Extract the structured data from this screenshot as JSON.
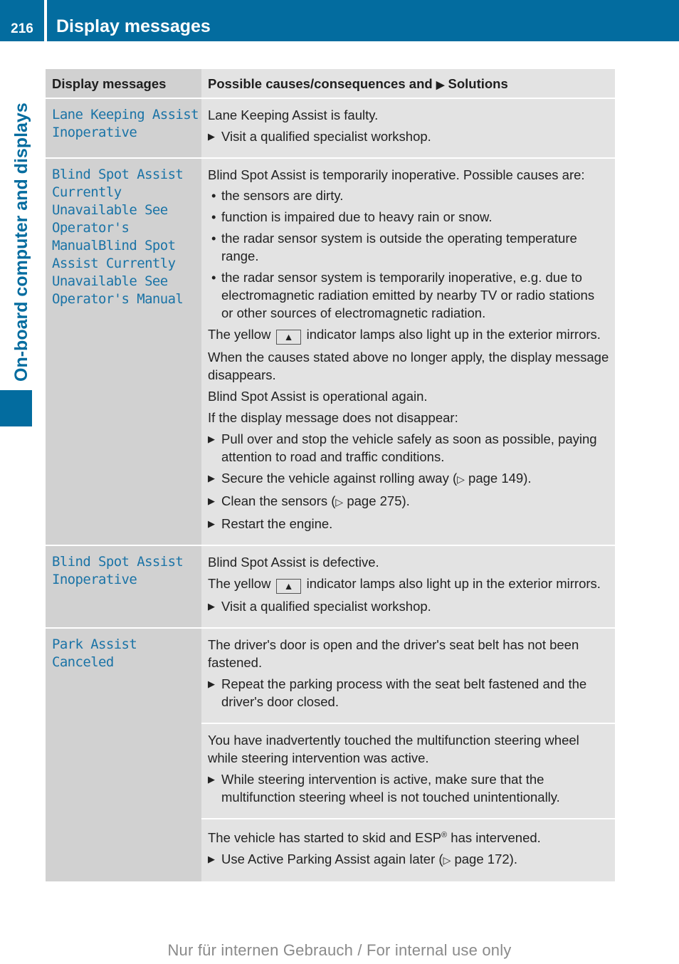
{
  "header": {
    "page_number": "216",
    "title": "Display messages",
    "side_tab": "On-board computer and displays",
    "accent_color": "#036c9f"
  },
  "table": {
    "col1_header": "Display messages",
    "col2_header_pre": "Possible causes/consequences and",
    "col2_header_marker": "▶",
    "col2_header_post": "Solutions",
    "rows": [
      {
        "message": "Lane Keeping Assist Inoperative",
        "blocks": [
          {
            "intro": "Lane Keeping Assist is faulty.",
            "steps": [
              "Visit a qualified specialist workshop."
            ]
          }
        ]
      },
      {
        "message": "Blind Spot Assist Currently Unavailable See Operator's ManualBlind Spot Assist Currently Unavailable See Operator's Manual",
        "intro": "Blind Spot Assist is temporarily inoperative. Possible causes are:",
        "bullets": [
          "the sensors are dirty.",
          "function is impaired due to heavy rain or snow.",
          "the radar sensor system is outside the operating temperature range.",
          "the radar sensor system is temporarily inoperative, e.g. due to electromagnetic radiation emitted by nearby TV or radio stations or other sources of electromagnetic radiation."
        ],
        "lamp_pre": "The yellow",
        "lamp_icon": "▲",
        "lamp_post": "indicator lamps also light up in the exterior mirrors.",
        "p1": "When the causes stated above no longer apply, the display message disappears.",
        "p2": "Blind Spot Assist is operational again.",
        "p3": "If the display message does not disappear:",
        "steps": [
          {
            "text": "Pull over and stop the vehicle safely as soon as possible, paying attention to road and traffic conditions.",
            "ref": ""
          },
          {
            "text": "Secure the vehicle against rolling away (",
            "ref": "page 149",
            "end": ")."
          },
          {
            "text": "Clean the sensors (",
            "ref": "page 275",
            "end": ")."
          },
          {
            "text": "Restart the engine.",
            "ref": ""
          }
        ]
      },
      {
        "message": "Blind Spot Assist Inoperative",
        "intro": "Blind Spot Assist is defective.",
        "lamp_pre": "The yellow",
        "lamp_icon": "▲",
        "lamp_post": "indicator lamps also light up in the exterior mirrors.",
        "steps": [
          "Visit a qualified specialist workshop."
        ]
      },
      {
        "message": "Park Assist Canceled",
        "blocks": [
          {
            "intro": "The driver's door is open and the driver's seat belt has not been fastened.",
            "steps": [
              "Repeat the parking process with the seat belt fastened and the driver's door closed."
            ]
          },
          {
            "intro": "You have inadvertently touched the multifunction steering wheel while steering intervention was active.",
            "steps": [
              "While steering intervention is active, make sure that the multifunction steering wheel is not touched unintentionally."
            ]
          },
          {
            "intro_pre": "The vehicle has started to skid and ESP",
            "intro_sup": "®",
            "intro_post": " has intervened.",
            "step_pre": "Use Active Parking Assist again later (",
            "step_ref": "page 172",
            "step_end": ")."
          }
        ]
      }
    ],
    "step_marker": "▶",
    "bullet_marker": "•",
    "ref_marker": "▷"
  },
  "footer": {
    "watermark": "Nur für internen Gebrauch / For internal use only"
  }
}
